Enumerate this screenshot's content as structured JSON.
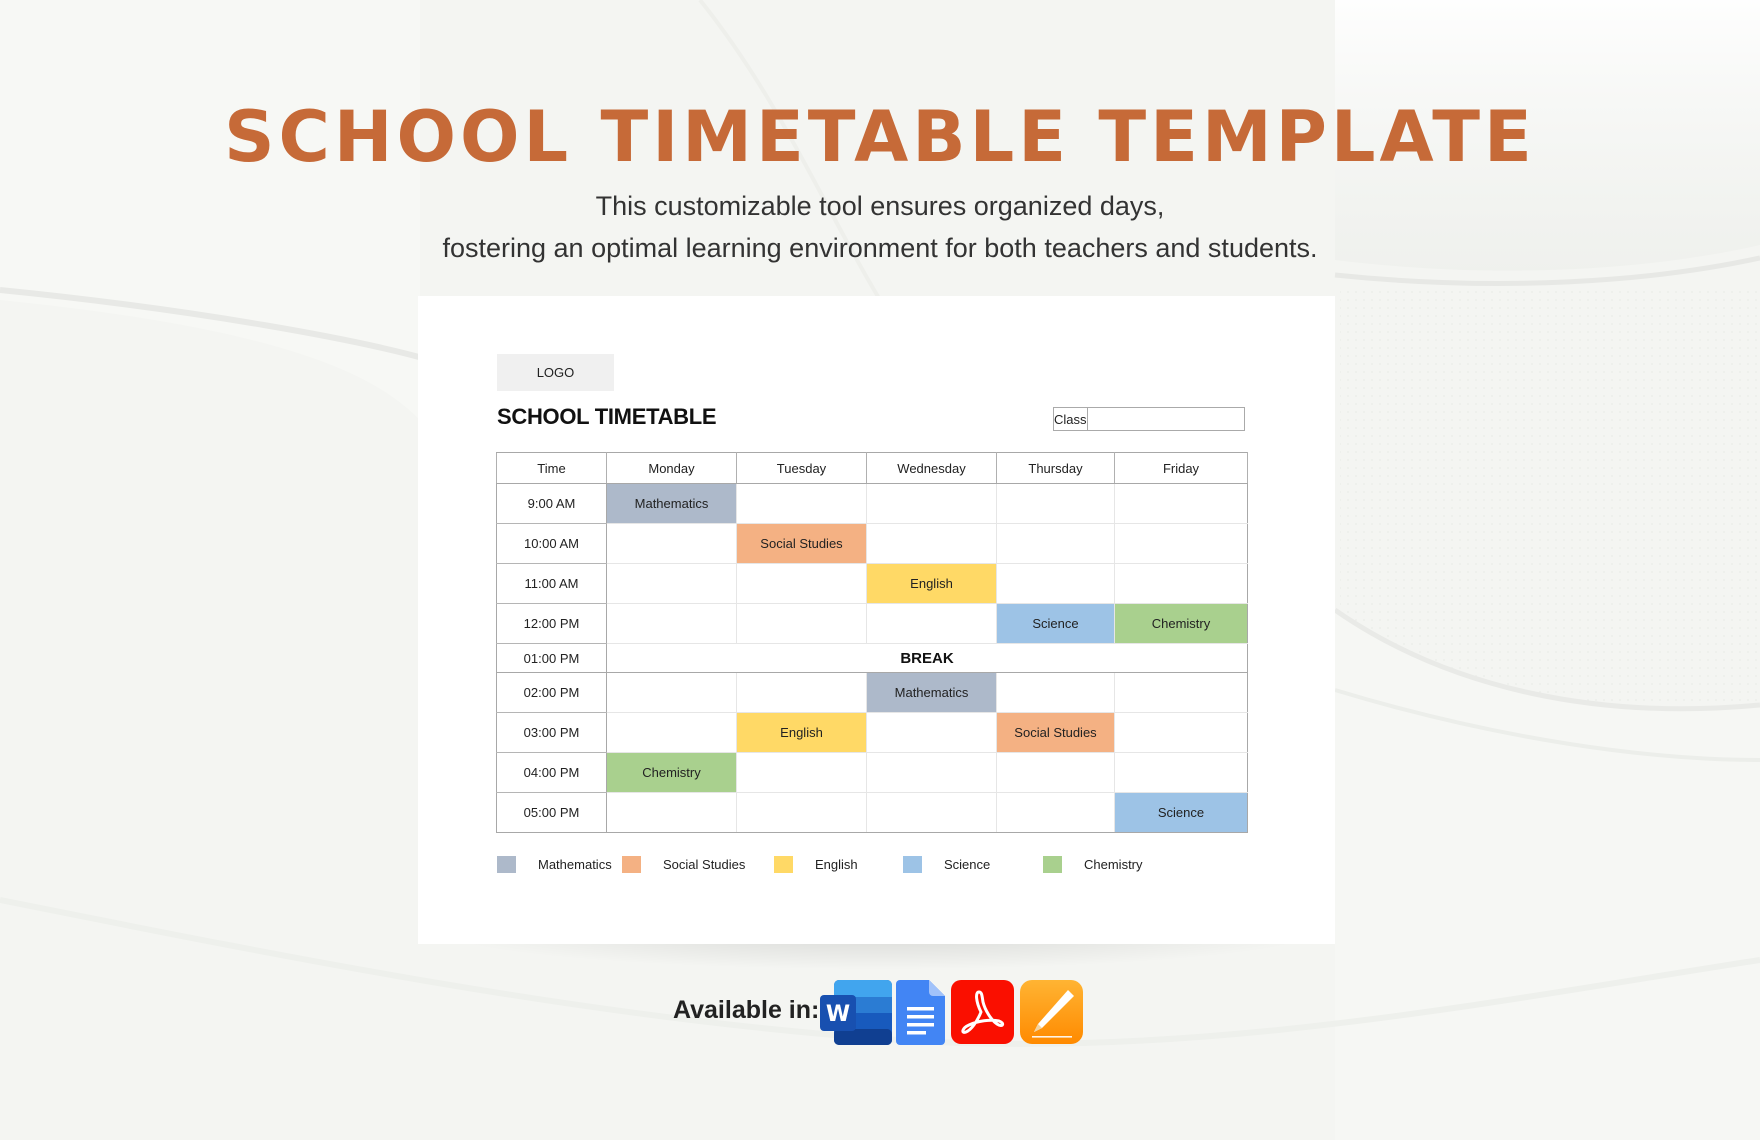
{
  "hero": {
    "title": "SCHOOL TIMETABLE TEMPLATE",
    "subtitle_line1": "This customizable tool ensures organized days,",
    "subtitle_line2": "fostering an optimal learning environment for both teachers and students."
  },
  "document": {
    "logo_label": "LOGO",
    "title": "SCHOOL TIMETABLE",
    "class_label": "Class",
    "class_value": "",
    "table": {
      "columns": [
        "Time",
        "Monday",
        "Tuesday",
        "Wednesday",
        "Thursday",
        "Friday"
      ],
      "rows": [
        {
          "time": "9:00 AM",
          "cells": [
            "Mathematics",
            "",
            "",
            "",
            ""
          ]
        },
        {
          "time": "10:00 AM",
          "cells": [
            "",
            "Social Studies",
            "",
            "",
            ""
          ]
        },
        {
          "time": "11:00 AM",
          "cells": [
            "",
            "",
            "English",
            "",
            ""
          ]
        },
        {
          "time": "12:00 PM",
          "cells": [
            "",
            "",
            "",
            "Science",
            "Chemistry"
          ]
        },
        {
          "time": "01:00 PM",
          "break": "BREAK"
        },
        {
          "time": "02:00 PM",
          "cells": [
            "",
            "",
            "Mathematics",
            "",
            ""
          ]
        },
        {
          "time": "03:00 PM",
          "cells": [
            "",
            "English",
            "",
            "Social Studies",
            ""
          ]
        },
        {
          "time": "04:00 PM",
          "cells": [
            "Chemistry",
            "",
            "",
            "",
            ""
          ]
        },
        {
          "time": "05:00 PM",
          "cells": [
            "",
            "",
            "",
            "",
            "Science"
          ]
        }
      ]
    },
    "legend": [
      {
        "label": "Mathematics",
        "color": "#ADB9CA"
      },
      {
        "label": "Social Studies",
        "color": "#F4B183"
      },
      {
        "label": "English",
        "color": "#FFD966"
      },
      {
        "label": "Science",
        "color": "#9DC3E6"
      },
      {
        "label": "Chemistry",
        "color": "#A9D08E"
      }
    ]
  },
  "footer": {
    "available_label": "Available in:",
    "apps": [
      {
        "name": "Microsoft Word",
        "icon": "word-icon"
      },
      {
        "name": "Google Docs",
        "icon": "google-docs-icon"
      },
      {
        "name": "Adobe PDF",
        "icon": "pdf-icon"
      },
      {
        "name": "Apple Pages",
        "icon": "pages-icon"
      }
    ]
  },
  "colors": {
    "accent": "#C66A38",
    "background": "#F4F5F2"
  }
}
